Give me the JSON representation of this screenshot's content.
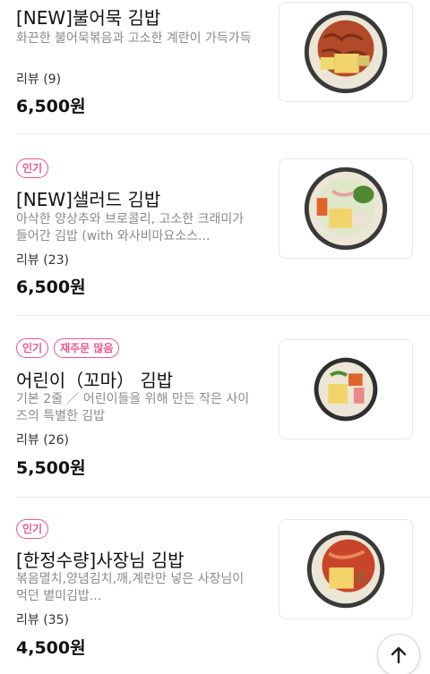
{
  "menu": {
    "items": [
      {
        "badges": [],
        "name": "[NEW]불어묵 김밥",
        "desc": "화끈한 불어묵볶음과 고소한 계란이 가득가득",
        "review": "리뷰 (9)",
        "price": "6,500원",
        "image_icon": "gimbap-fish-cake-icon"
      },
      {
        "badges": [
          "인기"
        ],
        "name": "[NEW]샐러드 김밥",
        "desc": "아삭한 양상추와 브로콜리, 고소한 크래미가 들어간 김밥 (with 와사비마요소스...",
        "review": "리뷰 (23)",
        "price": "6,500원",
        "image_icon": "gimbap-salad-icon"
      },
      {
        "badges": [
          "인기",
          "재주문 많음"
        ],
        "name": "어린이（꼬마） 김밥",
        "desc": "기본 2줄 ／ 어린이들을 위해 만든 작은 사이즈의 특별한 김밥",
        "review": "리뷰 (26)",
        "price": "5,500원",
        "image_icon": "gimbap-kids-icon"
      },
      {
        "badges": [
          "인기"
        ],
        "name": "[한정수량]사장님 김밥",
        "desc": "볶음멸치,양념김치,깨,계란만 넣은 사장님이 먹던 별미김밥...",
        "review": "리뷰 (35)",
        "price": "4,500원",
        "image_icon": "gimbap-kimchi-icon"
      }
    ]
  },
  "scroll_top_icon": "arrow-up-icon",
  "colors": {
    "badge": "#e8578f",
    "price": "#111111",
    "desc": "#8a8a8a"
  }
}
